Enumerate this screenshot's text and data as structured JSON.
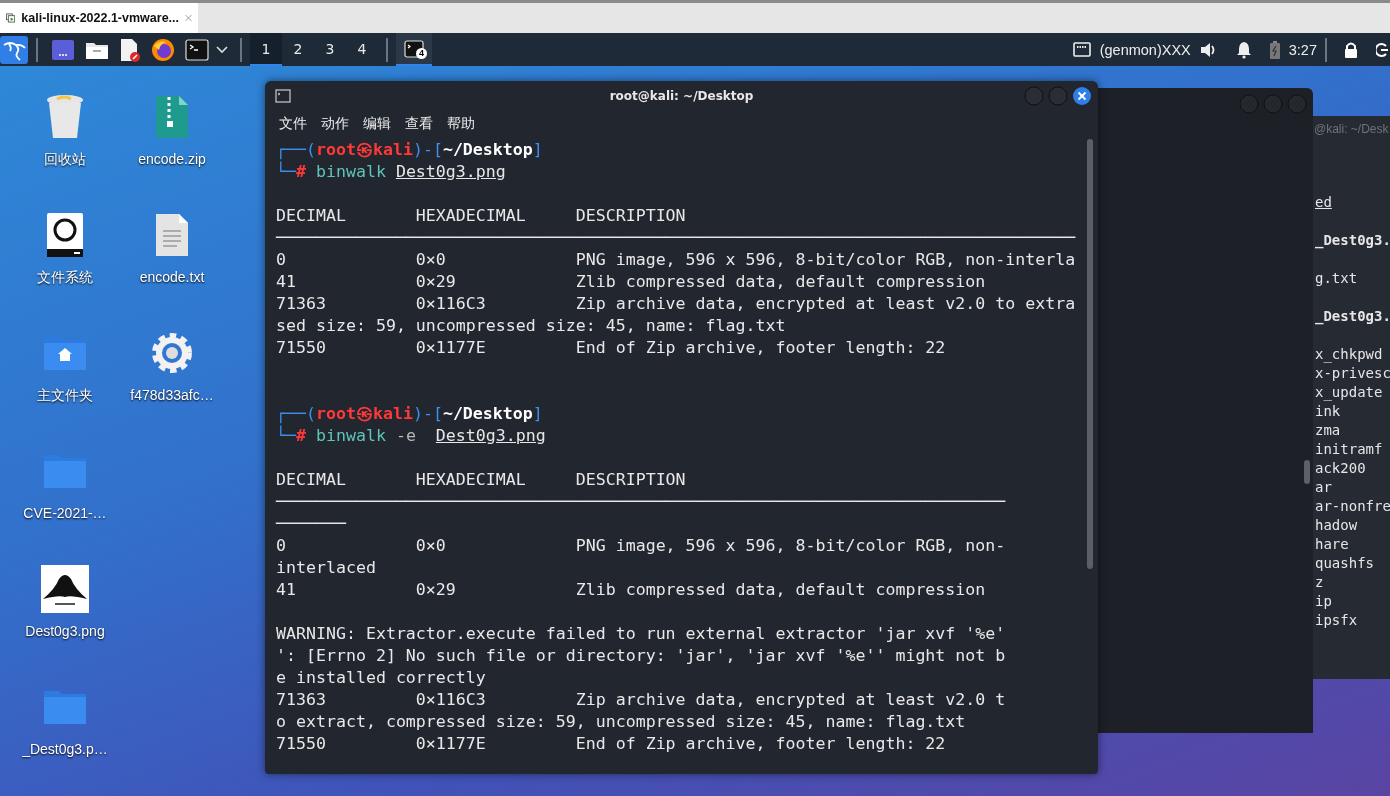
{
  "browser_tab": {
    "title": "kali-linux-2022.1-vmware..."
  },
  "taskbar": {
    "launchers": [
      {
        "kind": "desktop"
      },
      {
        "kind": "folder"
      },
      {
        "kind": "editor"
      },
      {
        "kind": "browser"
      },
      {
        "kind": "terminal"
      }
    ],
    "workspaces": [
      {
        "label": "1",
        "selected": true
      },
      {
        "label": "2",
        "selected": false
      },
      {
        "label": "3",
        "selected": false
      },
      {
        "label": "4",
        "selected": false
      }
    ],
    "task": {
      "badge": "4",
      "selected": true
    },
    "genmon": "(genmon)XXX",
    "clock": "3:27"
  },
  "desktop_icons": [
    {
      "label": "回收站",
      "kind": "trash"
    },
    {
      "label": "文件系统",
      "kind": "drive"
    },
    {
      "label": "主文件夹",
      "kind": "home"
    },
    {
      "label": "CVE-2021-…",
      "kind": "folder"
    },
    {
      "label": "Dest0g3.png"
    },
    {
      "label": "_Dest0g3.p…",
      "kind": "folder"
    },
    {
      "label": "encode.zip",
      "kind": "zip"
    },
    {
      "label": "encode.txt",
      "kind": "text"
    },
    {
      "label": "f478d33afc…",
      "kind": "gear"
    }
  ],
  "back_window": {
    "title": "@kali: ~/Desk",
    "top_lines": [
      {
        "text": "ed",
        "kind": "link"
      },
      {
        "text": "_Dest0g3.",
        "kind": "bold"
      },
      {
        "text": "g.txt",
        "kind": "plain"
      },
      {
        "text": "_Dest0g3.",
        "kind": "bold"
      }
    ],
    "list": [
      "x_chkpwd",
      "x-privesc",
      "x_update",
      "ink",
      "zma",
      "initramf",
      "ack200",
      "ar",
      "ar-nonfre",
      "hadow",
      "hare",
      "quashfs",
      "z",
      "ip",
      "ipsfx"
    ]
  },
  "terminal": {
    "title": "root@kali: ~/Desktop",
    "menu": [
      "文件",
      "动作",
      "编辑",
      "查看",
      "帮助"
    ],
    "lines": [
      {
        "kind": "prompt",
        "open": "┌──(",
        "user_host": "root㉿kali",
        "mid": ")-[",
        "path": "~/Desktop",
        "close": "]"
      },
      {
        "kind": "command",
        "corner": "└─",
        "sign": "#",
        "command": "binwalk",
        "argument": "Dest0g3.png"
      },
      {
        "kind": "blank"
      },
      {
        "kind": "text",
        "text": "DECIMAL       HEXADECIMAL     DESCRIPTION"
      },
      {
        "kind": "text",
        "text": "────────────────────────────────────────────────────────────────────────────────"
      },
      {
        "kind": "text",
        "text": "0             0×0             PNG image, 596 x 596, 8-bit/color RGB, non-interla"
      },
      {
        "kind": "text",
        "text": "41            0×29            Zlib compressed data, default compression"
      },
      {
        "kind": "text",
        "text": "71363         0×116C3         Zip archive data, encrypted at least v2.0 to extra"
      },
      {
        "kind": "text",
        "text": "sed size: 59, uncompressed size: 45, name: flag.txt"
      },
      {
        "kind": "text",
        "text": "71550         0×1177E         End of Zip archive, footer length: 22"
      },
      {
        "kind": "blank"
      },
      {
        "kind": "blank"
      },
      {
        "kind": "prompt",
        "open": "┌──(",
        "user_host": "root㉿kali",
        "mid": ")-[",
        "path": "~/Desktop",
        "close": "]"
      },
      {
        "kind": "command",
        "corner": "└─",
        "sign": "#",
        "command": "binwalk",
        "option": "-e",
        "argument": "Dest0g3.png"
      },
      {
        "kind": "blank"
      },
      {
        "kind": "text",
        "text": "DECIMAL       HEXADECIMAL     DESCRIPTION"
      },
      {
        "kind": "text",
        "text": "─────────────────────────────────────────────────────────────────────────"
      },
      {
        "kind": "text",
        "text": "───────"
      },
      {
        "kind": "text",
        "text": "0             0×0             PNG image, 596 x 596, 8-bit/color RGB, non-"
      },
      {
        "kind": "text",
        "text": "interlaced"
      },
      {
        "kind": "text",
        "text": "41            0×29            Zlib compressed data, default compression"
      },
      {
        "kind": "blank"
      },
      {
        "kind": "text",
        "text": "WARNING: Extractor.execute failed to run external extractor 'jar xvf '%e'"
      },
      {
        "kind": "text",
        "text": "': [Errno 2] No such file or directory: 'jar', 'jar xvf '%e'' might not b"
      },
      {
        "kind": "text",
        "text": "e installed correctly"
      },
      {
        "kind": "text",
        "text": "71363         0×116C3         Zip archive data, encrypted at least v2.0 t"
      },
      {
        "kind": "text",
        "text": "o extract, compressed size: 59, uncompressed size: 45, name: flag.txt"
      },
      {
        "kind": "text",
        "text": "71550         0×1177E         End of Zip archive, footer length: 22"
      }
    ]
  }
}
